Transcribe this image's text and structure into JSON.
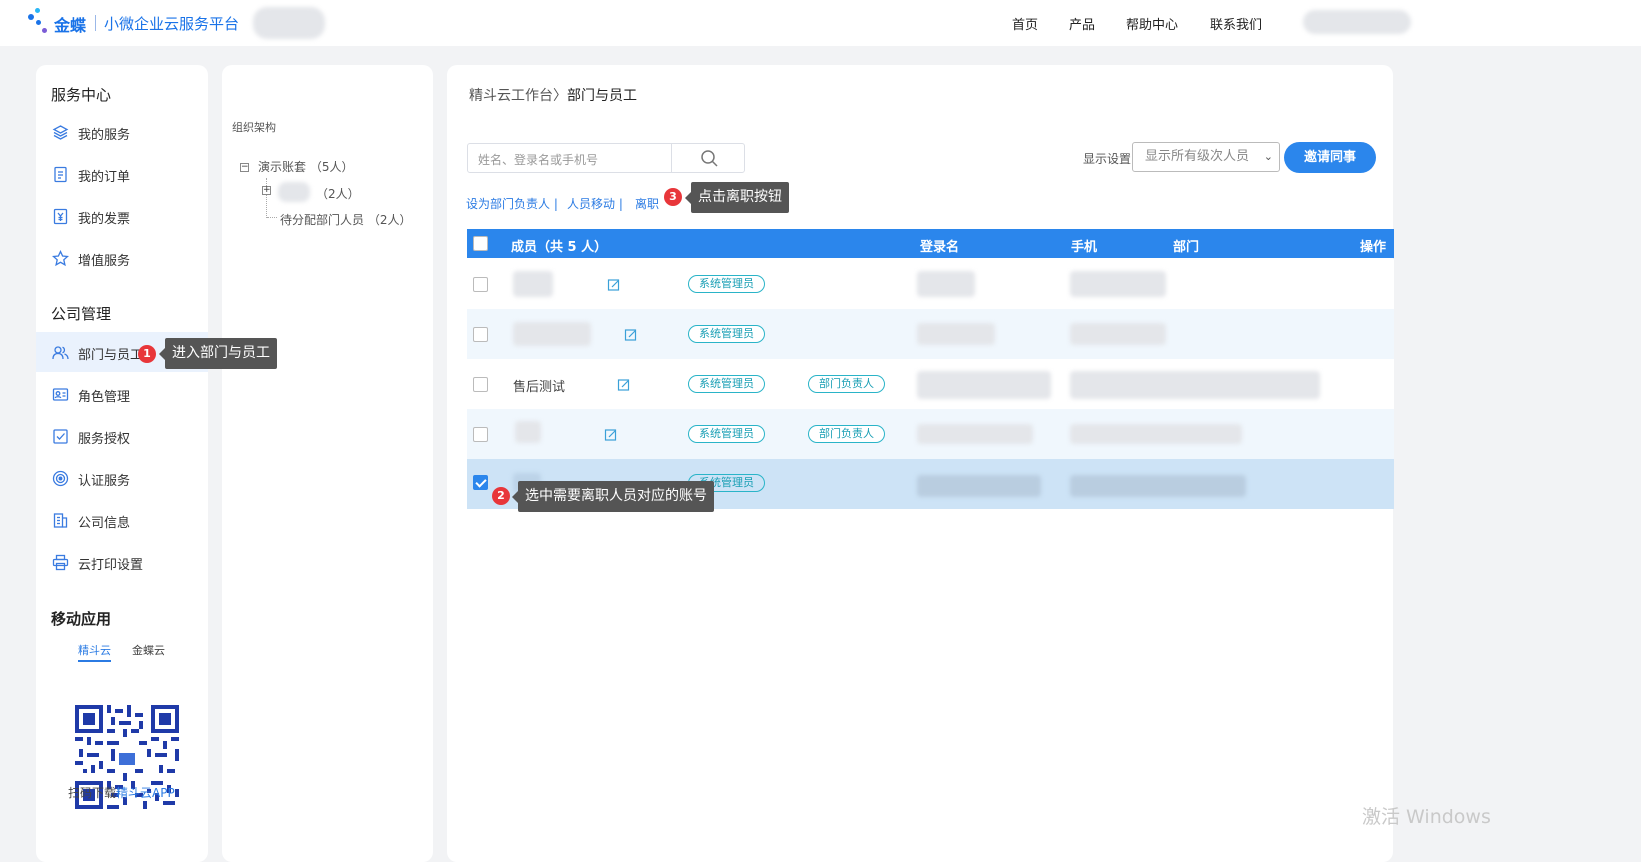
{
  "header": {
    "brand": "金蝶",
    "subtitle": "小微企业云服务平台",
    "nav": [
      "首页",
      "产品",
      "帮助中心",
      "联系我们"
    ]
  },
  "sidebar": {
    "service_title": "服务中心",
    "service_items": [
      {
        "label": "我的服务",
        "icon": "layers-icon"
      },
      {
        "label": "我的订单",
        "icon": "document-icon"
      },
      {
        "label": "我的发票",
        "icon": "invoice-icon"
      },
      {
        "label": "增值服务",
        "icon": "star-icon"
      }
    ],
    "company_title": "公司管理",
    "company_items": [
      {
        "label": "部门与员工",
        "icon": "users-icon",
        "active": true
      },
      {
        "label": "角色管理",
        "icon": "id-card-icon"
      },
      {
        "label": "服务授权",
        "icon": "check-square-icon"
      },
      {
        "label": "认证服务",
        "icon": "target-icon"
      },
      {
        "label": "公司信息",
        "icon": "building-icon"
      },
      {
        "label": "云打印设置",
        "icon": "printer-icon"
      }
    ],
    "mobile_title": "移动应用",
    "mobile_tabs": [
      "精斗云",
      "金蝶云"
    ],
    "download_prefix": "扫码下载",
    "download_link": "精斗云APP"
  },
  "tree": {
    "title": "组织架构",
    "root": "演示账套 （5人）",
    "child_count": "（2人）",
    "unassigned": "待分配部门人员 （2人）"
  },
  "main": {
    "breadcrumb_root": "精斗云工作台",
    "breadcrumb_sep": "〉",
    "breadcrumb_current": "部门与员工",
    "search_placeholder": "姓名、登录名或手机号",
    "display_label": "显示设置",
    "display_select": "显示所有级次人员",
    "invite_button": "邀请同事",
    "actions": [
      "设为部门负责人 |",
      "人员移动 |",
      "离职"
    ],
    "columns": {
      "member": "成员（共 5 人）",
      "login": "登录名",
      "phone": "手机",
      "dept": "部门",
      "op": "操作"
    },
    "rows": [
      {
        "name": "",
        "tags": [
          "系统管理员"
        ],
        "checked": false
      },
      {
        "name": "",
        "tags": [
          "系统管理员"
        ],
        "checked": false
      },
      {
        "name": "售后测试",
        "tags": [
          "系统管理员",
          "部门负责人"
        ],
        "checked": false
      },
      {
        "name": "",
        "tags": [
          "系统管理员",
          "部门负责人"
        ],
        "checked": false
      },
      {
        "name": "",
        "tags": [
          "系统管理员"
        ],
        "checked": true
      }
    ]
  },
  "annotations": {
    "step1_num": "1",
    "step1": "进入部门与员工",
    "step2_num": "2",
    "step2": "选中需要离职人员对应的账号",
    "step3_num": "3",
    "step3": "点击离职按钮"
  },
  "watermark": "激活 Windows",
  "colors": {
    "primary": "#2b86ec",
    "tag": "#2ab4c8",
    "badge": "#e8363a",
    "tooltip": "#555555"
  }
}
